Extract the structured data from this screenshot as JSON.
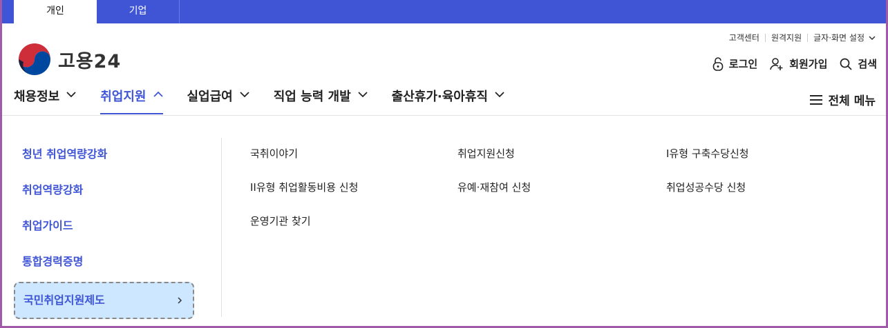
{
  "audience_tabs": [
    "개인",
    "기업"
  ],
  "util_links": [
    "고객센터",
    "원격지원",
    "글자·화면 설정"
  ],
  "logo": {
    "text": "고용24"
  },
  "account": {
    "login": "로그인",
    "signup": "회원가입",
    "search": "검색"
  },
  "gnb": [
    {
      "label": "채용정보",
      "active": false
    },
    {
      "label": "취업지원",
      "active": true
    },
    {
      "label": "실업급여",
      "active": false
    },
    {
      "label": "직업 능력 개발",
      "active": false
    },
    {
      "label": "출산휴가·육아휴직",
      "active": false
    }
  ],
  "full_menu": "전체 메뉴",
  "submenu": [
    "청년 취업역량강화",
    "취업역량강화",
    "취업가이드",
    "통합경력증명",
    "국민취업지원제도"
  ],
  "submenu_selected": "국민취업지원제도",
  "content_links": [
    "국취이야기",
    "취업지원신청",
    "I유형 구축수당신청",
    "II유형 취업활동비용 신청",
    "유예·재참여 신청",
    "취업성공수당 신청",
    "운영기관 찾기"
  ],
  "colors": {
    "brand": "#3f55d5",
    "selected_bg": "#cce7ff",
    "frame": "#a15aa8"
  }
}
